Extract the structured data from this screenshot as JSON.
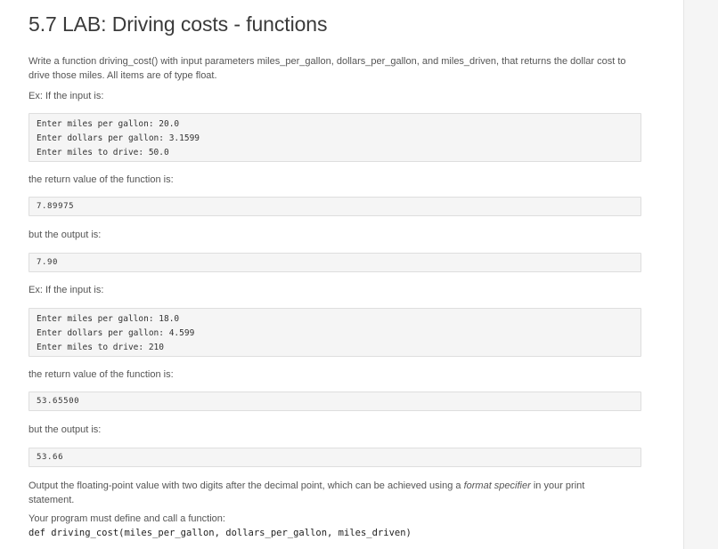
{
  "title": "5.7 LAB: Driving costs - functions",
  "intro": {
    "line1": "Write a function driving_cost() with input parameters miles_per_gallon, dollars_per_gallon, and miles_driven, that returns the dollar cost to",
    "line2": "drive those miles. All items are of type float."
  },
  "example1": {
    "label": "Ex: If the input is:",
    "input_lines": [
      "Enter miles per gallon: 20.0",
      "Enter dollars per gallon: 3.1599",
      "Enter miles to drive: 50.0"
    ],
    "return_label": "the return value of the function is:",
    "return_value": "7.89975",
    "output_label": "but the output is:",
    "output_value": "7.90"
  },
  "example2": {
    "label": "Ex: If the input is:",
    "input_lines": [
      "Enter miles per gallon: 18.0",
      "Enter dollars per gallon: 4.599",
      "Enter miles to drive: 210"
    ],
    "return_label": "the return value of the function is:",
    "return_value": "53.65500",
    "output_label": "but the output is:",
    "output_value": "53.66"
  },
  "format_note": {
    "before": "Output the floating-point value with two digits after the decimal point, which can be achieved using a ",
    "emphasis": "format specifier",
    "after": " in your print",
    "line2": "statement."
  },
  "must_define": "Your program must define and call a function:",
  "signature": "def driving_cost(miles_per_gallon, dollars_per_gallon, miles_driven)"
}
